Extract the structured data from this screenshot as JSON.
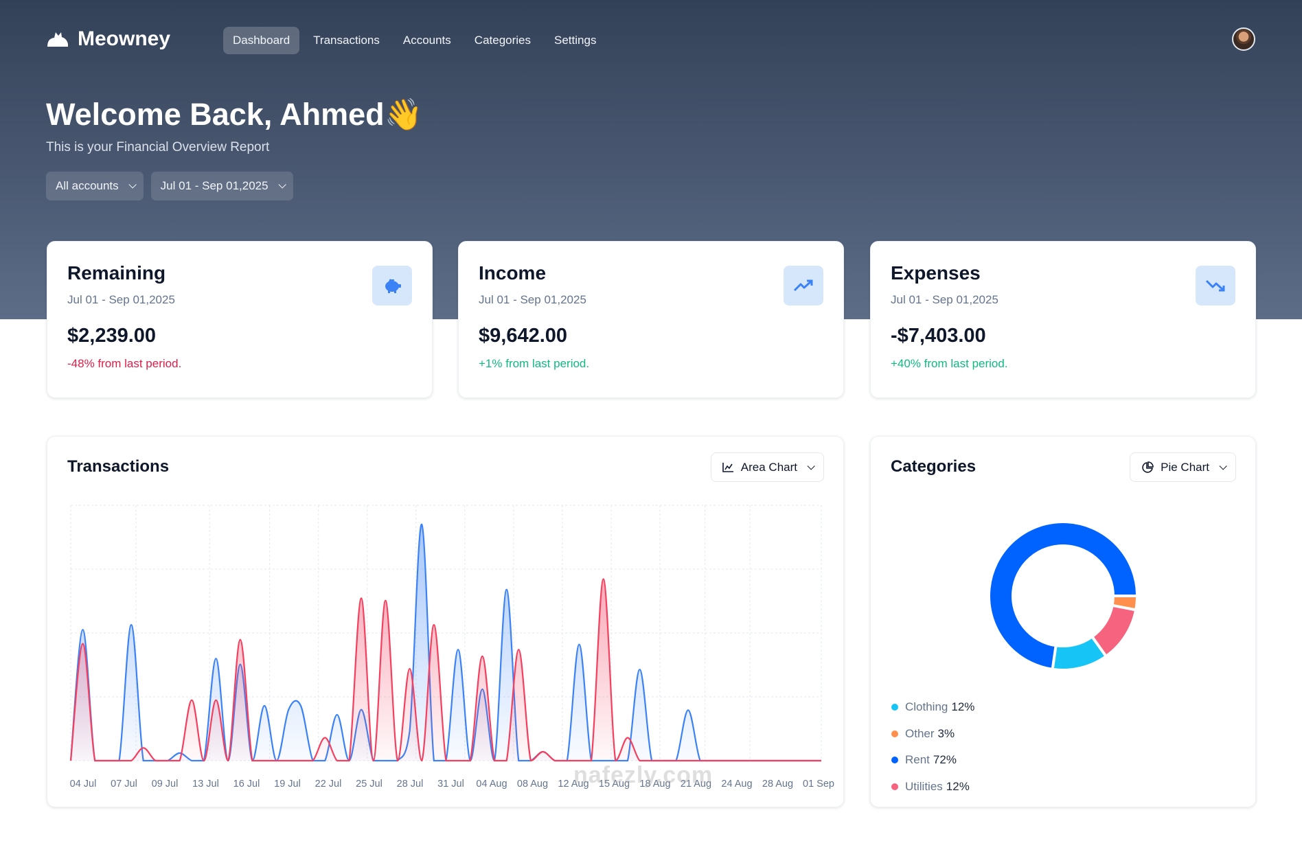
{
  "app": {
    "name": "Meowney",
    "logo_icon": "cat-icon"
  },
  "nav": {
    "items": [
      {
        "label": "Dashboard",
        "active": true
      },
      {
        "label": "Transactions"
      },
      {
        "label": "Accounts"
      },
      {
        "label": "Categories"
      },
      {
        "label": "Settings"
      }
    ]
  },
  "header": {
    "title": "Welcome Back, Ahmed",
    "emoji": "👋",
    "subtitle": "This is your Financial Overview Report",
    "account_filter": "All accounts",
    "date_filter": "Jul 01 - Sep 01,2025"
  },
  "cards": [
    {
      "title": "Remaining",
      "range": "Jul 01 - Sep 01,2025",
      "amount": "$2,239.00",
      "delta": "-48% from last period.",
      "trend": "negative",
      "icon": "piggy-bank-icon"
    },
    {
      "title": "Income",
      "range": "Jul 01 - Sep 01,2025",
      "amount": "$9,642.00",
      "delta": "+1% from last period.",
      "trend": "positive",
      "icon": "trending-up-icon"
    },
    {
      "title": "Expenses",
      "range": "Jul 01 - Sep 01,2025",
      "amount": "-$7,403.00",
      "delta": "+40% from last period.",
      "trend": "positive",
      "icon": "trending-down-icon"
    }
  ],
  "transactions_panel": {
    "title": "Transactions",
    "chart_type_label": "Area Chart"
  },
  "categories_panel": {
    "title": "Categories",
    "chart_type_label": "Pie Chart"
  },
  "watermark": "nafezly.com",
  "colors": {
    "income": "#3b82f6",
    "expense": "#f43f5e",
    "accent_bg": "#d6e6fb"
  },
  "chart_data": [
    {
      "type": "area",
      "grid": true,
      "x_ticks": [
        "04 Jul",
        "07 Jul",
        "09 Jul",
        "13 Jul",
        "16 Jul",
        "19 Jul",
        "22 Jul",
        "25 Jul",
        "28 Jul",
        "31 Jul",
        "04 Aug",
        "08 Aug",
        "12 Aug",
        "15 Aug",
        "18 Aug",
        "21 Aug",
        "24 Aug",
        "28 Aug",
        "01 Sep"
      ],
      "x_range": [
        "2025-07-01",
        "2025-09-01"
      ],
      "series": [
        {
          "key": "income",
          "color": "#3b82f6",
          "points": [
            [
              "2025-07-02",
              513
            ],
            [
              "2025-07-06",
              532
            ],
            [
              "2025-07-10",
              30
            ],
            [
              "2025-07-13",
              400
            ],
            [
              "2025-07-15",
              377
            ],
            [
              "2025-07-17",
              215
            ],
            [
              "2025-07-19",
              200
            ],
            [
              "2025-07-20",
              215
            ],
            [
              "2025-07-23",
              180
            ],
            [
              "2025-07-25",
              200
            ],
            [
              "2025-07-29",
              117
            ],
            [
              "2025-07-30",
              925
            ],
            [
              "2025-08-02",
              435
            ],
            [
              "2025-08-04",
              280
            ],
            [
              "2025-08-06",
              670
            ],
            [
              "2025-08-09",
              35
            ],
            [
              "2025-08-12",
              455
            ],
            [
              "2025-08-17",
              357
            ],
            [
              "2025-08-21",
              198
            ]
          ]
        },
        {
          "key": "expense",
          "color": "#f43f5e",
          "points": [
            [
              "2025-07-02",
              458
            ],
            [
              "2025-07-07",
              50
            ],
            [
              "2025-07-11",
              237
            ],
            [
              "2025-07-13",
              237
            ],
            [
              "2025-07-15",
              474
            ],
            [
              "2025-07-22",
              90
            ],
            [
              "2025-07-25",
              636
            ],
            [
              "2025-07-27",
              627
            ],
            [
              "2025-07-29",
              360
            ],
            [
              "2025-07-31",
              532
            ],
            [
              "2025-08-04",
              409
            ],
            [
              "2025-08-07",
              435
            ],
            [
              "2025-08-09",
              35
            ],
            [
              "2025-08-14",
              711
            ],
            [
              "2025-08-16",
              90
            ]
          ]
        }
      ]
    },
    {
      "type": "pie",
      "donut": true,
      "slices": [
        {
          "label": "Other",
          "value": 3,
          "color": "#ff8f4d"
        },
        {
          "label": "Utilities",
          "value": 12,
          "color": "#f6637e"
        },
        {
          "label": "Clothing",
          "value": 12,
          "color": "#16c5f5"
        },
        {
          "label": "Rent",
          "value": 72,
          "color": "#0062ff"
        }
      ],
      "legend": [
        {
          "label": "Clothing",
          "value": "12%",
          "color": "#16c5f5"
        },
        {
          "label": "Other",
          "value": "3%",
          "color": "#ff8f4d"
        },
        {
          "label": "Rent",
          "value": "72%",
          "color": "#0062ff"
        },
        {
          "label": "Utilities",
          "value": "12%",
          "color": "#f6637e"
        }
      ]
    }
  ]
}
